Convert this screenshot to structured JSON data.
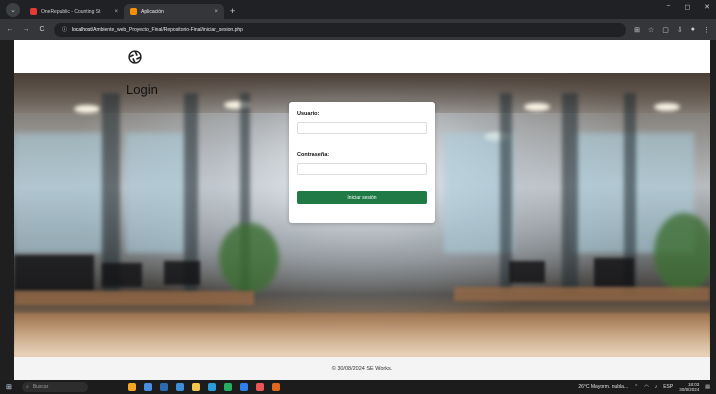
{
  "browser": {
    "tabs": [
      {
        "label": "OneRepublic - Counting St",
        "favicon_color": "#e53935",
        "close": "×"
      },
      {
        "label": "Aplicación",
        "favicon_color": "#ff8f00",
        "close": "×"
      }
    ],
    "new_tab": "+",
    "window_controls": {
      "minimize": "−",
      "maximize": "◻",
      "close": "✕"
    },
    "url": {
      "host": "localhost",
      "path": "/Ambiente_web_Proyecto_Final/Repositorio-Final/iniciar_sesion.php"
    },
    "icons": {
      "back": "←",
      "forward": "→",
      "reload": "C",
      "site_info": "ⓘ",
      "translate": "⊞",
      "bookmark": "☆",
      "extensions": "▢",
      "downloads": "⇩",
      "profile": "●",
      "menu": "⋮"
    }
  },
  "page": {
    "login_title": "Login",
    "form": {
      "username_label": "Usuario:",
      "username_value": "",
      "password_label": "Contraseña:",
      "password_value": "",
      "submit_label": "Iniciar sesión"
    },
    "footer_text": "© 30/08/2024 SE Works.",
    "colors": {
      "accent": "#1f7a46"
    }
  },
  "taskbar": {
    "search_placeholder": "Buscar",
    "weather": "26°C  Mayorm. nubla...",
    "language": "ESP",
    "time": "18:03",
    "date": "30/8/2024",
    "app_colors": [
      "#f5a623",
      "#4a90e2",
      "#2b6cb0",
      "#3b8fd9",
      "#f2c94c",
      "#2d9cdb",
      "#27ae60",
      "#2f80ed",
      "#eb5757",
      "#e0681f"
    ]
  }
}
